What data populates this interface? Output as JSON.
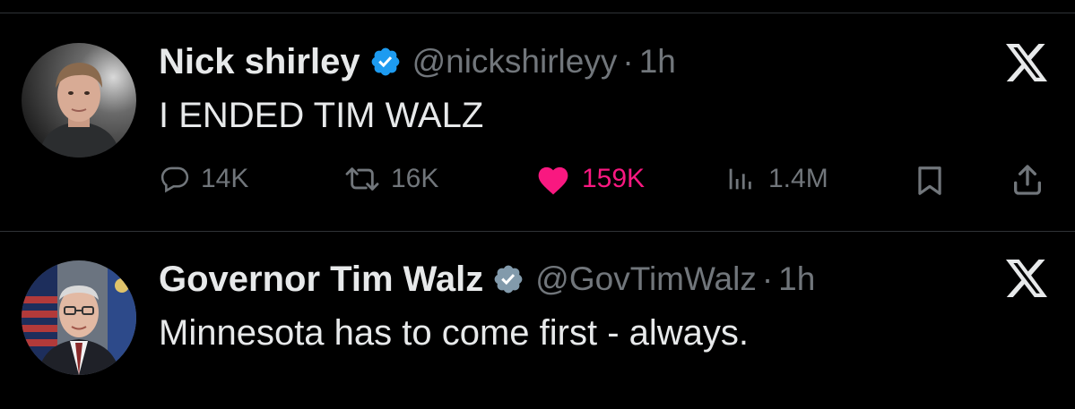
{
  "tweets": [
    {
      "author_name": "Nick shirley",
      "handle": "@nickshirleyy",
      "separator": "·",
      "time": "1h",
      "text": "I ENDED TIM WALZ",
      "verified": true,
      "close_icon": "x-logo-icon",
      "actions": {
        "replies": "14K",
        "reposts": "16K",
        "likes": "159K",
        "views": "1.4M"
      },
      "liked": true
    },
    {
      "author_name": "Governor Tim Walz",
      "handle": "@GovTimWalz",
      "separator": "·",
      "time": "1h",
      "text": "Minnesota has to come first - always.",
      "verified": true,
      "close_icon": "x-logo-icon"
    }
  ],
  "colors": {
    "background": "#000000",
    "text_primary": "#e7e9ea",
    "text_secondary": "#71767b",
    "verified_blue": "#1d9bf0",
    "like_pink": "#f91880",
    "divider": "#2f3336"
  }
}
